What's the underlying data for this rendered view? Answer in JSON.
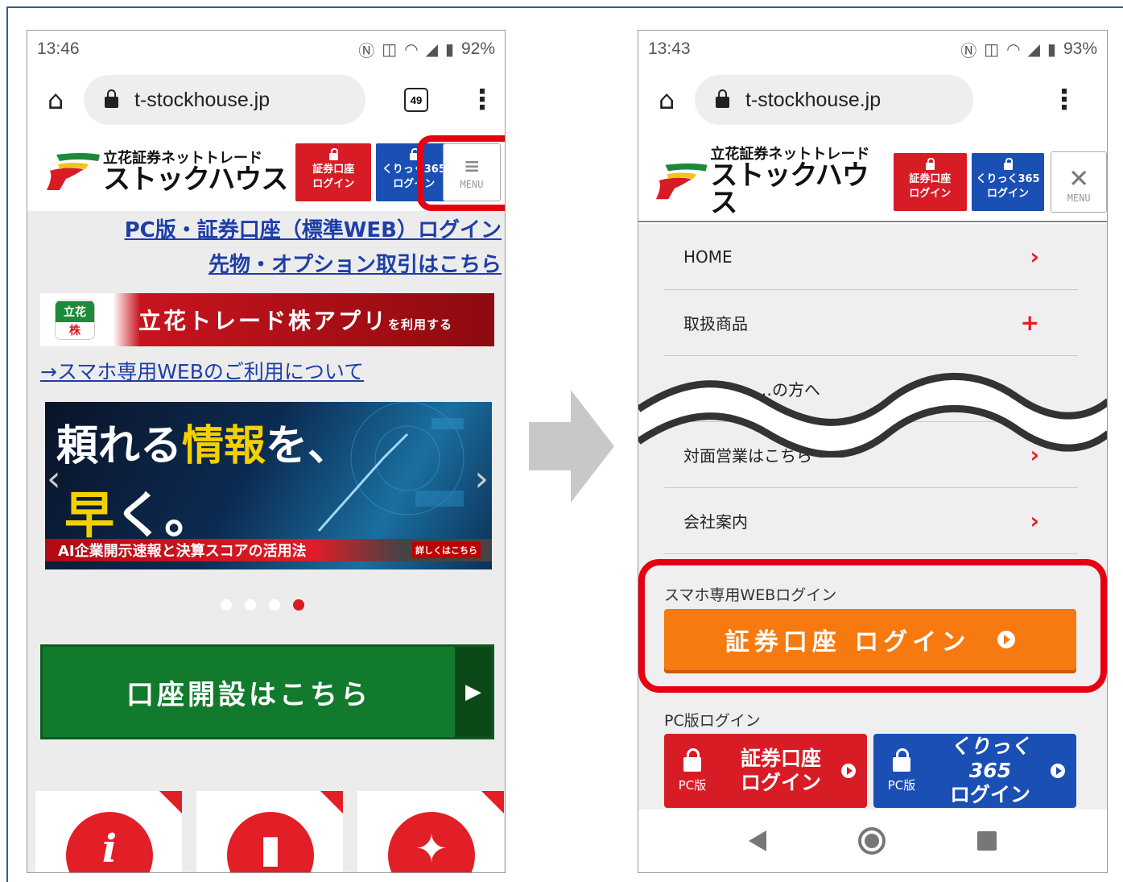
{
  "left": {
    "status": {
      "time": "13:46",
      "battery": "92%"
    },
    "url": "t-stockhouse.jp",
    "tab_count": "49",
    "logo": {
      "sub": "立花証券ネットトレード",
      "main": "ストックハウス"
    },
    "header_buttons": [
      {
        "line1": "証券口座",
        "line2": "ログイン"
      },
      {
        "line1": "くりっく365",
        "line2": "ログイン"
      }
    ],
    "menu_label": "MENU",
    "links": {
      "pc_login": "PC版・証券口座（標準WEB）ログイン",
      "futures": "先物・オプション取引はこちら",
      "smartphone": "→スマホ専用WEBのご利用について"
    },
    "app_banner": {
      "icon_top": "立花",
      "icon_bottom": "株",
      "text": "立花トレード株アプリ",
      "small": "を利用する"
    },
    "hero": {
      "line1_a": "頼れる",
      "line1_b": "情報",
      "line1_c": "を、",
      "line2_a": "早",
      "line2_b": "く。",
      "strip": "AI企業開示速報と決算スコアの活用法",
      "more": "詳しくはこちら"
    },
    "open_account": "口座開設はこちら"
  },
  "right": {
    "status": {
      "time": "13:43",
      "battery": "93%"
    },
    "url": "t-stockhouse.jp",
    "logo": {
      "sub": "立花証券ネットトレード",
      "main": "ストックハウス"
    },
    "header_buttons": [
      {
        "line1": "証券口座",
        "line2": "ログイン"
      },
      {
        "line1": "くりっく365",
        "line2": "ログイン"
      }
    ],
    "menu_label": "MENU",
    "menu_items": [
      {
        "label": "HOME",
        "icon": "›"
      },
      {
        "label": "取扱商品",
        "icon": "+"
      },
      {
        "label": "…の方へ",
        "icon": ""
      },
      {
        "label": "対面営業はこちら",
        "icon": "›"
      },
      {
        "label": "会社案内",
        "icon": "›"
      }
    ],
    "smart_login_section": "スマホ専用WEBログイン",
    "smart_login_button": "証券口座 ログイン",
    "pc_login_section": "PC版ログイン",
    "pc_buttons": [
      {
        "side": "PC版",
        "line1": "証券口座",
        "line2": "ログイン"
      },
      {
        "side": "PC版",
        "line1": "くりっく365",
        "line2": "ログイン"
      }
    ]
  },
  "colors": {
    "highlight": "#e50012",
    "brand_red": "#d71c26",
    "brand_blue": "#1a4fb3",
    "brand_green": "#127a2d",
    "orange": "#f67a0f"
  }
}
